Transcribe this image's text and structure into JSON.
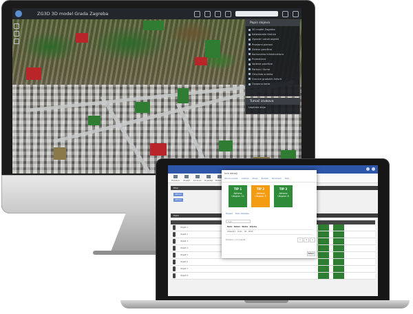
{
  "desktop_app": {
    "title": "ZG3D 3D model Grada Zagreba",
    "search_placeholder": "",
    "layers_panel": {
      "header": "Popis slojeva",
      "items": [
        "3D model Zagreba",
        "Katastarske čestice",
        "Zgrade i ostali objekti",
        "Prostorni planovi",
        "Zelene površine",
        "Komunalna infrastruktura",
        "Prometnice",
        "Vodene površine",
        "Parkovi i šume",
        "Orto-foto snimka",
        "Granice gradskih četvrti",
        "Osnovna karta"
      ]
    },
    "legend_panel": {
      "header": "Tumač znakova",
      "subheader": "Legenda sloja"
    }
  },
  "laptop_app": {
    "nav_items": [
      "Početna",
      "Objekti",
      "Korisnici",
      "Izvještaji",
      "Postavke",
      "Pomoć"
    ],
    "section_filter": "Filtar",
    "section_list": "Popis",
    "tag_label": "Aktivno",
    "modal": {
      "title": "Info detalji",
      "tabs": [
        "Osnovni podaci",
        "Lokacija",
        "Stanje",
        "Povijest",
        "Dokumenti",
        "Slike"
      ],
      "tiles": [
        {
          "title": "TIP 1",
          "lines": [
            "Aktivno",
            "Ukupno: 12"
          ],
          "color": "#2e8b38"
        },
        {
          "title": "TIP 2",
          "lines": [
            "Aktivno",
            "Ukupno: 5"
          ],
          "color": "#f39c12"
        },
        {
          "title": "TIP 3",
          "lines": [
            "Aktivno",
            "Ukupno: 8"
          ],
          "color": "#2e8b38"
        }
      ],
      "sub_tabs": [
        "Pregled",
        "Popis obilazaka"
      ],
      "search_placeholder": "Traži...",
      "table_headers": [
        "Naziv",
        "Datum",
        "Status",
        "Vrijeme"
      ],
      "table_rows": [
        [
          "Obilazak 1",
          "01.01.",
          "OK",
          "10:00"
        ]
      ],
      "info_text": "Prikazano 1 od 1 zapisa",
      "pager": [
        "<",
        "1",
        ">"
      ],
      "close_label": "Zatvori"
    },
    "table_rows": [
      {
        "id": "1",
        "name": "Objekt 1"
      },
      {
        "id": "2",
        "name": "Objekt 2"
      },
      {
        "id": "3",
        "name": "Objekt 3"
      },
      {
        "id": "4",
        "name": "Objekt 4"
      },
      {
        "id": "5",
        "name": "Objekt 5"
      },
      {
        "id": "6",
        "name": "Objekt 6"
      },
      {
        "id": "7",
        "name": "Objekt 7"
      },
      {
        "id": "8",
        "name": "Objekt 8"
      }
    ]
  },
  "colors": {
    "app_header": "#2e56a8",
    "status_green": "#2f7d32",
    "tile_orange": "#f39c12"
  }
}
